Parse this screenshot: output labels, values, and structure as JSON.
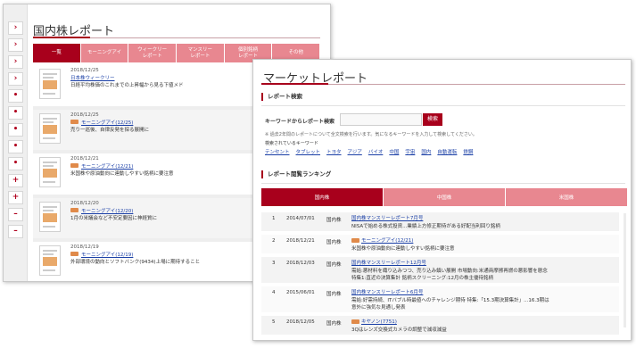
{
  "back": {
    "title": "国内株レポート",
    "side_glyphs": [
      "›",
      "›",
      "›",
      "›",
      "•",
      "•",
      "•",
      "•",
      "•",
      "+",
      "+",
      "–",
      "–"
    ],
    "tabs": [
      "一覧",
      "モーニングアイ",
      "ウィークリー\nレポート",
      "マンスリー\nレポート",
      "個別銘柄\nレポート",
      "その他"
    ],
    "reports": [
      {
        "date": "2018/12/25",
        "badge": false,
        "link": "日本株ウィークリー",
        "desc": "日経平均株価のこれまでの上昇幅から見る下値メド"
      },
      {
        "date": "2018/12/25",
        "badge": true,
        "link": "モーニングアイ(12/25)",
        "desc": "売り一巡後、自律反発を探る展開に"
      },
      {
        "date": "2018/12/21",
        "badge": true,
        "link": "モーニングアイ(12/21)",
        "desc": "米国株や原油動向に連動しやすい銘柄に要注意"
      },
      {
        "date": "2018/12/20",
        "badge": true,
        "link": "モーニングアイ(12/20)",
        "desc": "1月の米議会など不安定要因に神経質に"
      },
      {
        "date": "2018/12/19",
        "badge": true,
        "link": "モーニングアイ(12/19)",
        "desc": "外部環境の動向とソフトバンク(9434)上場に期待すること"
      }
    ]
  },
  "front": {
    "title": "マーケットレポート",
    "search": {
      "heading": "レポート検索",
      "label": "キーワードからレポート検索",
      "button": "検索",
      "note": "※ 過去2年間のレポートについて全文検索を行います。気になるキーワードを入力して検索してください。",
      "sub": "検索されているキーワード",
      "tags": [
        "テンセント",
        "タブレット",
        "トヨタ",
        "アジア",
        "バイオ",
        "中国",
        "宇宙",
        "国内",
        "自動運転",
        "鉄鋼"
      ]
    },
    "ranking": {
      "heading": "レポート閲覧ランキング",
      "tabs": [
        "国内株",
        "中国株",
        "米国株"
      ],
      "rows": [
        {
          "num": "1",
          "date": "2014/07/01",
          "cat": "国内株",
          "badge": false,
          "title": "国内株マンスリーレポート7月号",
          "desc": "NISAで始める株式投資...業績上方修正期待がある好配当利回り銘柄"
        },
        {
          "num": "2",
          "date": "2018/12/21",
          "cat": "国内株",
          "badge": true,
          "title": "モーニングアイ(12/21)",
          "desc": "米国株や原油動向に連動しやすい銘柄に要注意"
        },
        {
          "num": "3",
          "date": "2018/12/03",
          "cat": "国内株",
          "badge": false,
          "title": "国内株マンスリーレポート12月号",
          "desc": "需給:悪材料を織り込みつつ、売り込み鎮い展開 市場動向:米通商摩擦再燃の悪影響を懸念 特集1:直近の決算集計 銘柄スクリーニング:12月の株主優待銘柄"
        },
        {
          "num": "4",
          "date": "2015/06/01",
          "cat": "国内株",
          "badge": false,
          "title": "国内株マンスリーレポート6月号",
          "desc": "需給:好需持続、ITバブル時最値へのチャレンジ期待 特集:「15.3期決算集計」...16.3期は意外に強気な見通し発表"
        },
        {
          "num": "5",
          "date": "2018/12/05",
          "cat": "国内株",
          "badge": true,
          "title": "キヤノン(7751)",
          "desc": "3Qはレンズ交換式カメラの調整で減収減益"
        }
      ]
    }
  }
}
